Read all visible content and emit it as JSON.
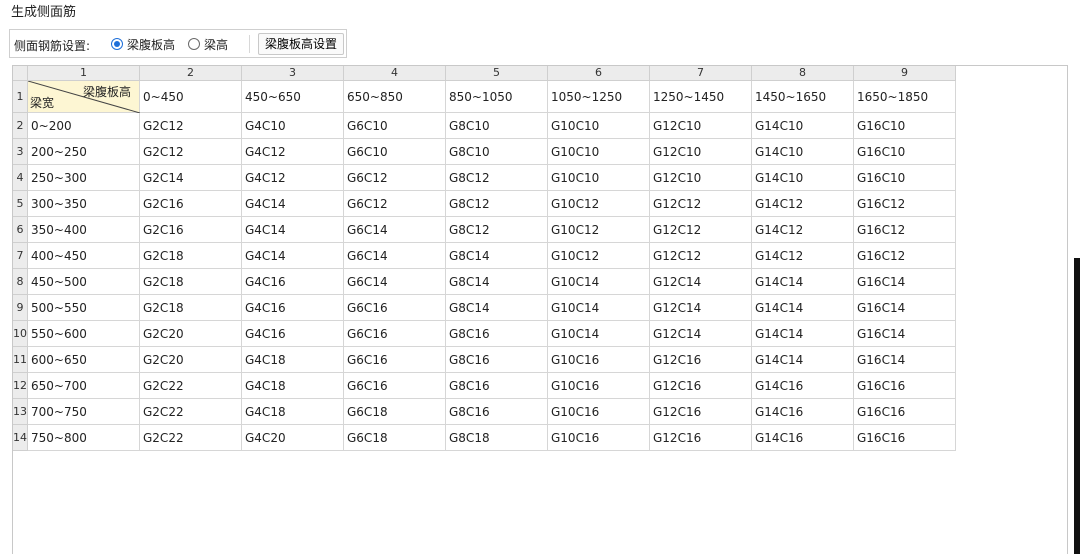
{
  "title": "生成侧面筋",
  "toolbar": {
    "label": "侧面钢筋设置:",
    "radio_options": [
      {
        "label": "梁腹板高",
        "checked": true
      },
      {
        "label": "梁高",
        "checked": false
      }
    ],
    "button_label": "梁腹板高设置"
  },
  "table": {
    "column_numbers": [
      "1",
      "2",
      "3",
      "4",
      "5",
      "6",
      "7",
      "8",
      "9"
    ],
    "row_numbers": [
      "1",
      "2",
      "3",
      "4",
      "5",
      "6",
      "7",
      "8",
      "9",
      "10",
      "11",
      "12",
      "13",
      "14"
    ],
    "corner_top_label": "梁腹板高",
    "corner_bottom_label": "梁宽",
    "height_ranges": [
      "0~450",
      "450~650",
      "650~850",
      "850~1050",
      "1050~1250",
      "1250~1450",
      "1450~1650",
      "1650~1850"
    ],
    "rows": [
      {
        "width": "0~200",
        "values": [
          "G2C12",
          "G4C10",
          "G6C10",
          "G8C10",
          "G10C10",
          "G12C10",
          "G14C10",
          "G16C10"
        ]
      },
      {
        "width": "200~250",
        "values": [
          "G2C12",
          "G4C12",
          "G6C10",
          "G8C10",
          "G10C10",
          "G12C10",
          "G14C10",
          "G16C10"
        ]
      },
      {
        "width": "250~300",
        "values": [
          "G2C14",
          "G4C12",
          "G6C12",
          "G8C12",
          "G10C10",
          "G12C10",
          "G14C10",
          "G16C10"
        ]
      },
      {
        "width": "300~350",
        "values": [
          "G2C16",
          "G4C14",
          "G6C12",
          "G8C12",
          "G10C12",
          "G12C12",
          "G14C12",
          "G16C12"
        ]
      },
      {
        "width": "350~400",
        "values": [
          "G2C16",
          "G4C14",
          "G6C14",
          "G8C12",
          "G10C12",
          "G12C12",
          "G14C12",
          "G16C12"
        ]
      },
      {
        "width": "400~450",
        "values": [
          "G2C18",
          "G4C14",
          "G6C14",
          "G8C14",
          "G10C12",
          "G12C12",
          "G14C12",
          "G16C12"
        ]
      },
      {
        "width": "450~500",
        "values": [
          "G2C18",
          "G4C16",
          "G6C14",
          "G8C14",
          "G10C14",
          "G12C14",
          "G14C14",
          "G16C14"
        ]
      },
      {
        "width": "500~550",
        "values": [
          "G2C18",
          "G4C16",
          "G6C16",
          "G8C14",
          "G10C14",
          "G12C14",
          "G14C14",
          "G16C14"
        ]
      },
      {
        "width": "550~600",
        "values": [
          "G2C20",
          "G4C16",
          "G6C16",
          "G8C16",
          "G10C14",
          "G12C14",
          "G14C14",
          "G16C14"
        ]
      },
      {
        "width": "600~650",
        "values": [
          "G2C20",
          "G4C18",
          "G6C16",
          "G8C16",
          "G10C16",
          "G12C16",
          "G14C14",
          "G16C14"
        ]
      },
      {
        "width": "650~700",
        "values": [
          "G2C22",
          "G4C18",
          "G6C16",
          "G8C16",
          "G10C16",
          "G12C16",
          "G14C16",
          "G16C16"
        ]
      },
      {
        "width": "700~750",
        "values": [
          "G2C22",
          "G4C18",
          "G6C18",
          "G8C16",
          "G10C16",
          "G12C16",
          "G14C16",
          "G16C16"
        ]
      },
      {
        "width": "750~800",
        "values": [
          "G2C22",
          "G4C20",
          "G6C18",
          "G8C18",
          "G10C16",
          "G12C16",
          "G14C16",
          "G16C16"
        ]
      }
    ]
  },
  "colors": {
    "accent": "#1e6fd9",
    "corner_cell_bg": "#fdf6d3",
    "header_bg": "#ececec"
  }
}
